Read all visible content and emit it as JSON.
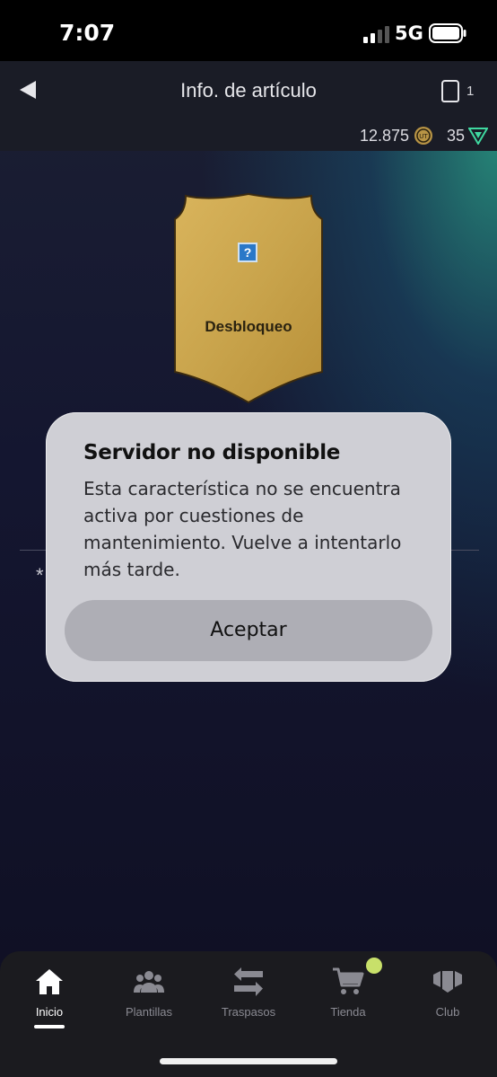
{
  "status_bar": {
    "time": "7:07",
    "network": "5G"
  },
  "header": {
    "title": "Info. de artículo",
    "inventory_count": "1"
  },
  "currency": {
    "coins": "12.875",
    "points": "35"
  },
  "item": {
    "label": "Desbloqueo",
    "placeholder_icon": "question-mark-icon"
  },
  "dialog": {
    "title": "Servidor no disponible",
    "message": "Esta característica no se encuentra activa por cuestiones de mantenimiento. Vuelve a intentarlo más tarde.",
    "accept_label": "Aceptar"
  },
  "background_text": {
    "asterisk": "*"
  },
  "nav": {
    "items": [
      {
        "label": "Inicio",
        "icon": "home-icon",
        "active": true
      },
      {
        "label": "Plantillas",
        "icon": "group-icon",
        "active": false
      },
      {
        "label": "Traspasos",
        "icon": "transfer-arrows-icon",
        "active": false
      },
      {
        "label": "Tienda",
        "icon": "shopping-cart-icon",
        "active": false
      },
      {
        "label": "Club",
        "icon": "club-icon",
        "active": false
      }
    ]
  },
  "colors": {
    "card_gold": "#c9a44c",
    "badge": "#c8e06a",
    "dialog_bg": "#cfcfd5"
  }
}
